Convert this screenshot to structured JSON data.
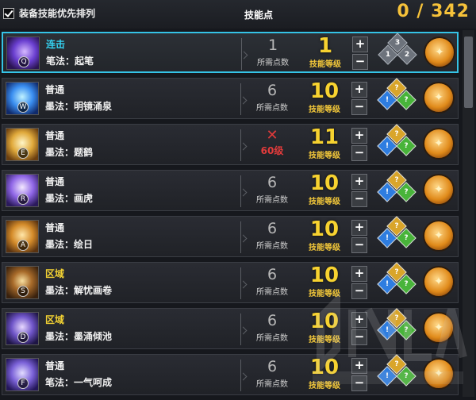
{
  "header": {
    "checkbox_label": "装备技能优先排列",
    "points_label": "技能点",
    "points_value": "0 / 342"
  },
  "labels": {
    "required_points": "所需点数",
    "skill_level": "技能等级",
    "plus": "+",
    "minus": "−"
  },
  "skills": [
    {
      "category": "连击",
      "category_style": "combo",
      "name": "笔法：起笔",
      "key": "Q",
      "required": "1",
      "level": "1",
      "locked": false,
      "icon": "purple-brush",
      "gems": [
        "3",
        "1",
        "2"
      ],
      "gems_style": "gray",
      "selected": true
    },
    {
      "category": "普通",
      "category_style": "normal",
      "name": "墨法：明镜涌泉",
      "key": "W",
      "required": "6",
      "level": "10",
      "locked": false,
      "icon": "blue-spring",
      "gems": [
        "?",
        "!",
        "?"
      ],
      "gems_style": "color",
      "selected": false
    },
    {
      "category": "普通",
      "category_style": "normal",
      "name": "墨法：题鹤",
      "key": "E",
      "required": "",
      "level": "11",
      "locked": true,
      "lock_text": "60级",
      "icon": "gold-crane",
      "gems": [
        "?",
        "!",
        "?"
      ],
      "gems_style": "color",
      "selected": false
    },
    {
      "category": "普通",
      "category_style": "normal",
      "name": "墨法：画虎",
      "key": "R",
      "required": "6",
      "level": "10",
      "locked": false,
      "icon": "violet-tiger",
      "gems": [
        "?",
        "!",
        "?"
      ],
      "gems_style": "color",
      "selected": false
    },
    {
      "category": "普通",
      "category_style": "normal",
      "name": "墨法：绘日",
      "key": "A",
      "required": "6",
      "level": "10",
      "locked": false,
      "icon": "orange-sun",
      "gems": [
        "?",
        "!",
        "?"
      ],
      "gems_style": "color",
      "selected": false
    },
    {
      "category": "区域",
      "category_style": "zone",
      "name": "墨法：解忧画卷",
      "key": "S",
      "required": "6",
      "level": "10",
      "locked": false,
      "icon": "dark-scroll",
      "gems": [
        "?",
        "!",
        "?"
      ],
      "gems_style": "color",
      "selected": false
    },
    {
      "category": "区域",
      "category_style": "zone",
      "name": "墨法：墨涌倾池",
      "key": "D",
      "required": "6",
      "level": "10",
      "locked": false,
      "icon": "ink-pool",
      "gems": [
        "?",
        "!",
        "?"
      ],
      "gems_style": "color",
      "selected": false
    },
    {
      "category": "普通",
      "category_style": "normal",
      "name": "笔法：一气呵成",
      "key": "F",
      "required": "6",
      "level": "10",
      "locked": false,
      "icon": "mist-stroke",
      "gems": [
        "?",
        "!",
        "?"
      ],
      "gems_style": "color",
      "selected": false
    }
  ],
  "icon_classes": {
    "purple-brush": "ic-purple",
    "blue-spring": "ic-blue",
    "gold-crane": "ic-gold",
    "violet-tiger": "ic-violet",
    "orange-sun": "ic-orange",
    "dark-scroll": "ic-dark",
    "ink-pool": "ic-ink",
    "mist-stroke": "ic-mist"
  },
  "colors": {
    "accent_gold": "#f7d230",
    "selection_cyan": "#35c3e6",
    "combo_cyan": "#35d3f2",
    "zone_yellow": "#f3d233",
    "lock_red": "#e03a3a"
  }
}
